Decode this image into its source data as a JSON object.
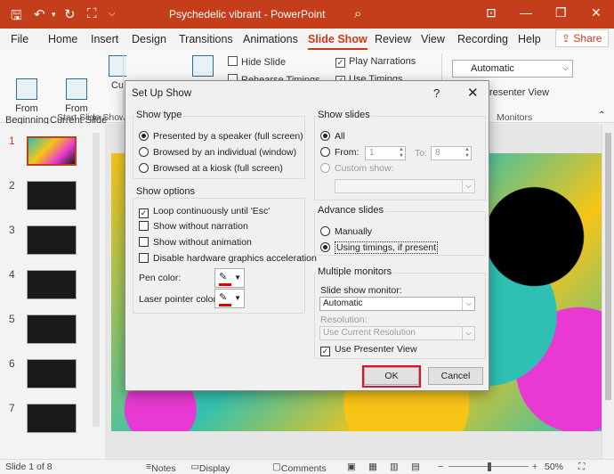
{
  "app": {
    "title": "Psychedelic vibrant  -  PowerPoint",
    "quick_access": [
      "save-icon",
      "undo-icon",
      "undo-dropdown-icon",
      "redo-icon",
      "customize-icon"
    ]
  },
  "tabs": [
    "File",
    "Home",
    "Insert",
    "Design",
    "Transitions",
    "Animations",
    "Slide Show",
    "Review",
    "View",
    "Recording",
    "Help"
  ],
  "active_tab": "Slide Show",
  "share_label": "Share",
  "ribbon": {
    "from_beginning": "From\nBeginning",
    "from_current": "From\nCurrent Slide",
    "custom_partial": "Cu",
    "start_group": "Start Slide Show",
    "hide_slide": "Hide Slide",
    "rehearse": "Rehearse Timings",
    "play_narrations": "Play Narrations",
    "use_timings": "Use Timings",
    "monitor_value": "Automatic",
    "presenter_view_partial": "resenter View",
    "monitors_group": "Monitors"
  },
  "thumbnails": [
    {
      "num": "1",
      "active": true
    },
    {
      "num": "2",
      "active": false
    },
    {
      "num": "3",
      "active": false
    },
    {
      "num": "4",
      "active": false
    },
    {
      "num": "5",
      "active": false
    },
    {
      "num": "6",
      "active": false
    },
    {
      "num": "7",
      "active": false
    }
  ],
  "status": {
    "slide_count": "Slide 1 of 8",
    "notes": "Notes",
    "display_settings": "Display Settings",
    "comments": "Comments",
    "zoom": "50%"
  },
  "dialog": {
    "title": "Set Up Show",
    "show_type": {
      "label": "Show type",
      "options": [
        "Presented by a speaker (full screen)",
        "Browsed by an individual (window)",
        "Browsed at a kiosk (full screen)"
      ],
      "selected": 0
    },
    "show_options": {
      "label": "Show options",
      "checks": [
        {
          "label": "Loop continuously until 'Esc'",
          "checked": true
        },
        {
          "label": "Show without narration",
          "checked": false
        },
        {
          "label": "Show without animation",
          "checked": false
        },
        {
          "label": "Disable hardware graphics acceleration",
          "checked": false
        }
      ],
      "pen_color": "Pen color:",
      "laser_color": "Laser pointer color:"
    },
    "show_slides": {
      "label": "Show slides",
      "all": "All",
      "from": "From:",
      "from_value": "1",
      "to": "To:",
      "to_value": "8",
      "custom": "Custom show:"
    },
    "advance": {
      "label": "Advance slides",
      "manually": "Manually",
      "timings": "Using timings, if present"
    },
    "monitors": {
      "label": "Multiple monitors",
      "monitor_label": "Slide show monitor:",
      "monitor_value": "Automatic",
      "resolution_label": "Resolution:",
      "resolution_value": "Use Current Resolution",
      "presenter_view": "Use Presenter View"
    },
    "ok": "OK",
    "cancel": "Cancel"
  }
}
